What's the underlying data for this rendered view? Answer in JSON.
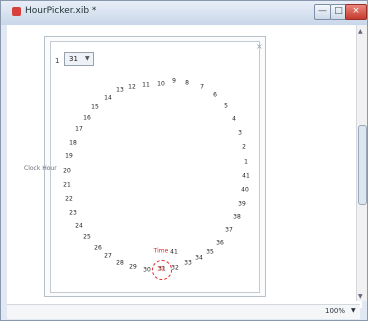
{
  "window": {
    "title": "HourPicker.xib *"
  },
  "controls": {
    "minimize": "—",
    "maximize": "□",
    "close": "×"
  },
  "panel": {
    "close": "×"
  },
  "left_label": "Clock Hour",
  "picker": {
    "prefix": "1",
    "selected_value": "31",
    "dropdown_arrow": "▼"
  },
  "clock": {
    "numbers": [
      "31",
      "32",
      "33",
      "34",
      "35",
      "36",
      "37",
      "38",
      "39",
      "40",
      "41",
      "1",
      "2",
      "3",
      "4",
      "5",
      "6",
      "7",
      "8",
      "9",
      "10",
      "11",
      "12",
      "13",
      "14",
      "15",
      "16",
      "17",
      "18",
      "19",
      "20",
      "21",
      "22",
      "23",
      "24",
      "25",
      "26",
      "27",
      "28",
      "29",
      "30",
      "41"
    ],
    "selected_label": "Time",
    "selected_number": "31"
  },
  "scrollbar": {
    "up": "▲",
    "down": "▼"
  },
  "status": {
    "zoom": "100%",
    "zoom_arrow": "▼"
  },
  "colors": {
    "accent": "#e3271f"
  }
}
